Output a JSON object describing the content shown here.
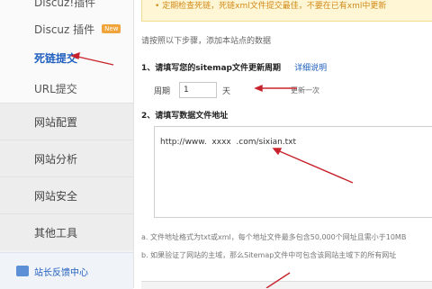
{
  "sidebar": {
    "items": [
      {
        "label": "Discuz!插件"
      },
      {
        "label": "Discuz 插件",
        "badge": "New"
      },
      {
        "label": "死链提交"
      },
      {
        "label": "URL提交"
      },
      {
        "label": "网站配置"
      },
      {
        "label": "网站分析"
      },
      {
        "label": "网站安全"
      },
      {
        "label": "其他工具"
      }
    ],
    "feedback": "站长反馈中心"
  },
  "notice": "• 定期检查死链，死链xml文件提交最佳，不要在已有xml中更新",
  "intro": "请按照以下步骤，添加本站点的数据",
  "step1": {
    "title": "1、请填写您的sitemap文件更新周期",
    "link": "详细说明",
    "freq_label": "周期",
    "freq_value": "1",
    "freq_unit": "天",
    "freq_note": "更新一次"
  },
  "step2": {
    "title": "2、请填写数据文件地址",
    "url_value": "http://www.  xxxx  .com/sixian.txt"
  },
  "notes": [
    "a. 文件地址格式为txt或xml，每个地址文件最多包含50,000个网址且需小于10MB",
    "b. 如果验证了网站的主域，那么Sitemap文件中可包含该网站主域下的所有网址"
  ]
}
